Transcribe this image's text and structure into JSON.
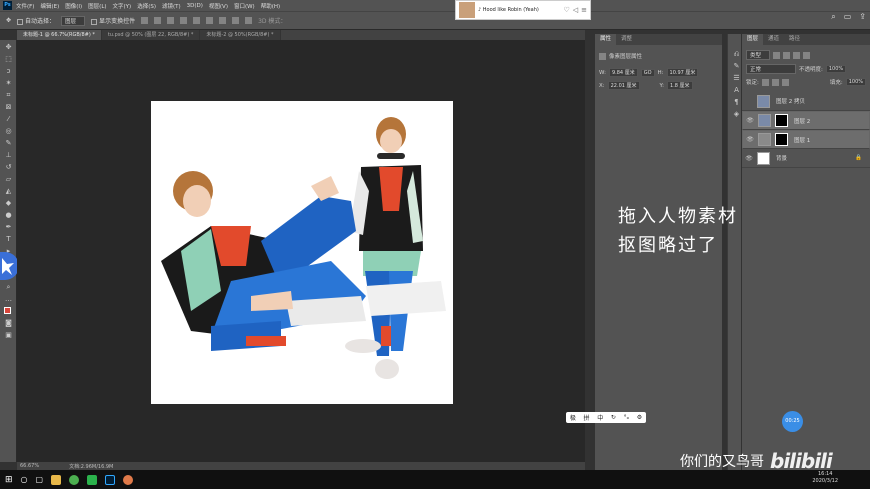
{
  "menubar": {
    "app_icon": "Ps",
    "items": [
      "文件(F)",
      "编辑(E)",
      "图像(I)",
      "图层(L)",
      "文字(Y)",
      "选择(S)",
      "滤镜(T)",
      "3D(D)",
      "视图(V)",
      "窗口(W)",
      "帮助(H)"
    ]
  },
  "options": {
    "auto_select": "自动选择：",
    "layer_select": "图层",
    "show_transform": "显示变换控件",
    "mode3d": "3D 模式："
  },
  "tabs": [
    "未标题-1 @ 66.7%(RGB/8#) *",
    "tu.psd @ 50% (图层 22, RGB/8#) *",
    "未标题-2 @ 50%(RGB/8#) *"
  ],
  "status": {
    "zoom": "66.67%",
    "doc": "文档:2.96M/16.9M"
  },
  "player": {
    "track": "♪ Hood like Robin (Yeah)"
  },
  "properties": {
    "tabs": [
      "属性",
      "调整"
    ],
    "title": "像素图层属性",
    "w_label": "W:",
    "w": "9.84 厘米",
    "go": "GO",
    "h_label": "H:",
    "h": "10.97 厘米",
    "x_label": "X:",
    "x": "22.01 厘米",
    "y_label": "Y:",
    "y": "1.8 厘米"
  },
  "layers": {
    "tabs": [
      "图层",
      "通道",
      "路径"
    ],
    "kind": "类型",
    "blend": "正常",
    "opacity_label": "不透明度:",
    "opacity": "100%",
    "lock_label": "锁定:",
    "fill_label": "填充:",
    "fill": "100%",
    "rows": [
      {
        "name": "图层 2 拷贝",
        "visible": false,
        "selected": false
      },
      {
        "name": "图层 2",
        "visible": true,
        "selected": true
      },
      {
        "name": "图层 1",
        "visible": true,
        "selected": true
      },
      {
        "name": "背景",
        "visible": true,
        "selected": false
      }
    ]
  },
  "overlay": {
    "line1": "拖入人物素材",
    "line2": "抠图略过了"
  },
  "ime": [
    "极",
    "拼",
    "中",
    "↻",
    "°ₒ",
    "⚙"
  ],
  "timer": "00:25",
  "watermark": {
    "text": "你们的又鸟哥",
    "logo": "bilibili"
  },
  "clock": {
    "time": "16:14",
    "date": "2020/3/12"
  }
}
